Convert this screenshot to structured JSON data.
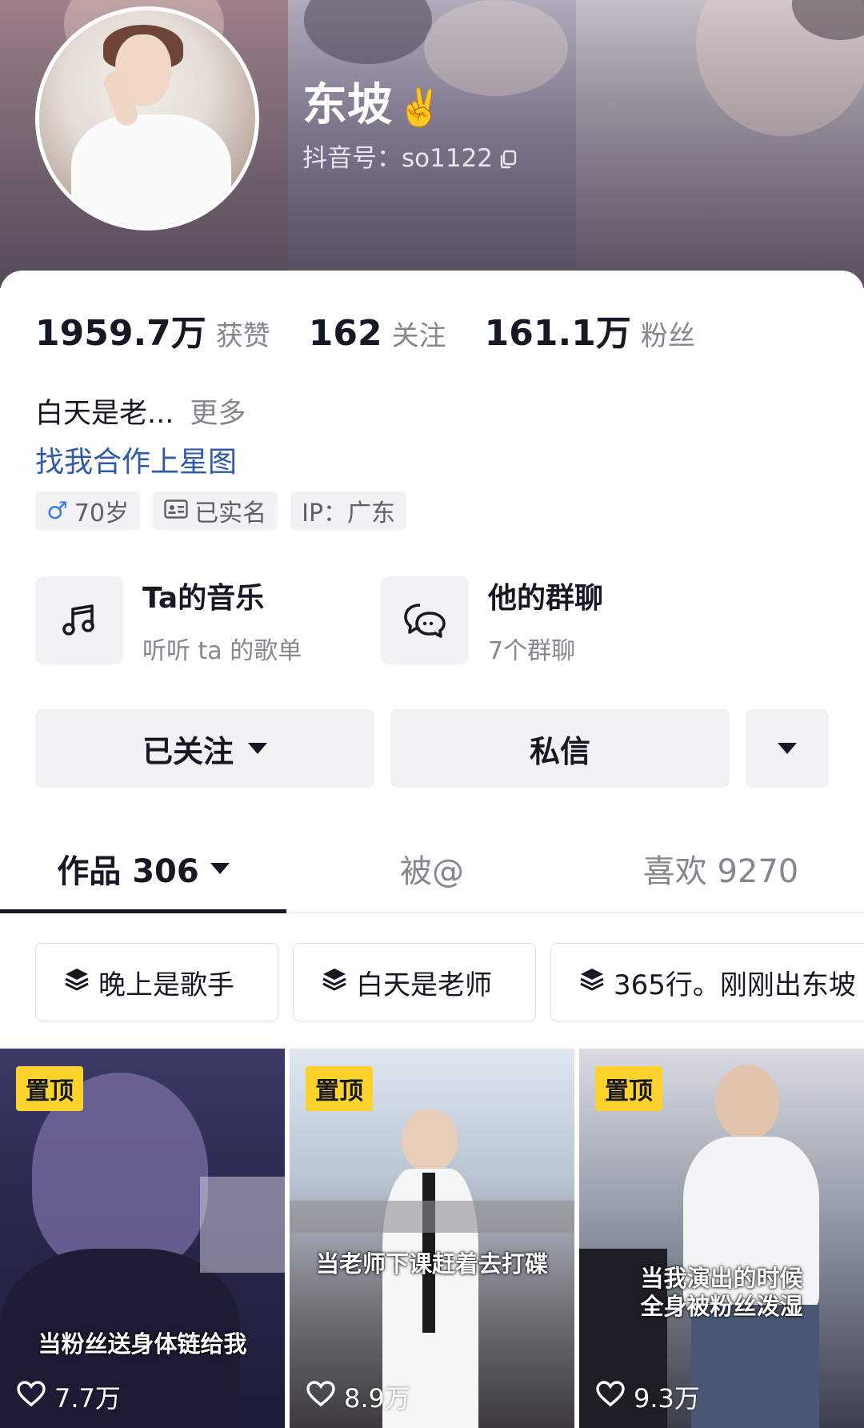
{
  "profile": {
    "name": "东坡",
    "name_emoji": "✌️",
    "douyin_id": "抖音号：so1122"
  },
  "stats": [
    {
      "value": "1959.7万",
      "label": "获赞"
    },
    {
      "value": "162",
      "label": "关注"
    },
    {
      "value": "161.1万",
      "label": "粉丝"
    }
  ],
  "bio": {
    "text": "白天是老...",
    "more": "更多",
    "link": "找我合作上星图"
  },
  "tags": {
    "age": "70岁",
    "verified": "已实名",
    "ip": "IP：广东"
  },
  "entries": {
    "music": {
      "title": "Ta的音乐",
      "subtitle": "听听 ta 的歌单"
    },
    "groups": {
      "title": "他的群聊",
      "subtitle": "7个群聊"
    }
  },
  "actions": {
    "follow": "已关注",
    "message": "私信"
  },
  "tabs": [
    {
      "label": "作品 306"
    },
    {
      "label": "被@"
    },
    {
      "label": "喜欢 9270"
    }
  ],
  "collections": [
    "晚上是歌手",
    "白天是老师",
    "365行。刚刚出东坡"
  ],
  "videos": [
    {
      "pin": "置顶",
      "caption": "当粉丝送身体链给我",
      "likes": "7.7万"
    },
    {
      "pin": "置顶",
      "caption": "当老师下课赶着去打碟",
      "likes": "8.9万"
    },
    {
      "pin": "置顶",
      "caption": "当我演出的时候\n全身被粉丝泼湿",
      "likes": "9.3万"
    }
  ],
  "colors": {
    "link": "#2e5aa8",
    "pin_badge": "#fcd22d",
    "male_icon": "#3c7ded"
  }
}
